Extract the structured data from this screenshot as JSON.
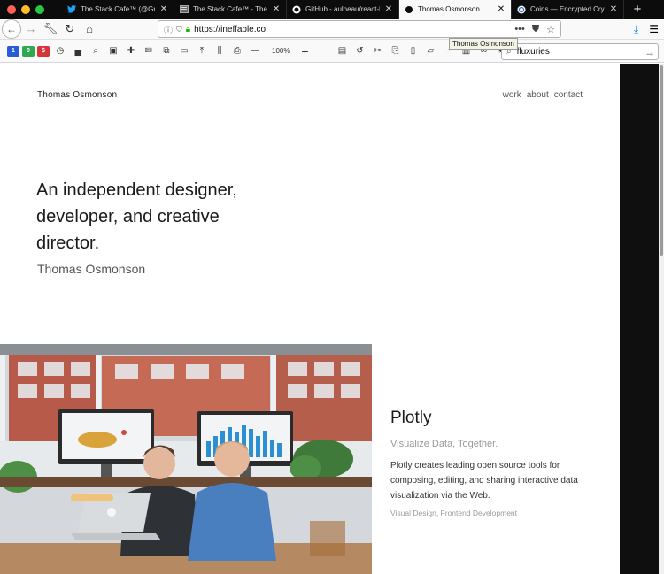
{
  "tabs": [
    {
      "label": "The Stack Cafe™ (@Grid",
      "icon": "twitter-icon",
      "active": false
    },
    {
      "label": "The Stack Cafe™ - The S",
      "icon": "page-icon",
      "active": false
    },
    {
      "label": "GitHub - aulneau/react-li",
      "icon": "github-icon",
      "active": false
    },
    {
      "label": "Thomas Osmonson",
      "icon": "dot-icon",
      "active": true
    },
    {
      "label": "Coins — Encrypted Crypt",
      "icon": "coin-icon",
      "active": false
    }
  ],
  "navbar": {
    "url": "https://ineffable.co",
    "tooltip": "Thomas Osmonson"
  },
  "toolbar": {
    "badges": [
      {
        "text": "1",
        "color": "#2a5bd7"
      },
      {
        "text": "0",
        "color": "#2fa84f"
      },
      {
        "text": "$",
        "color": "#d6333a"
      }
    ],
    "zoom": "100%"
  },
  "search": {
    "value": "fluxuries"
  },
  "site": {
    "brand": "Thomas Osmonson",
    "menu": [
      "work",
      "about",
      "contact"
    ],
    "hero": "An independent designer, developer, and creative director.",
    "hero_sub": "Thomas Osmonson"
  },
  "project": {
    "title": "Plotly",
    "tagline": "Visualize Data, Together.",
    "description": "Plotly creates leading open source tools for composing, editing, and sharing interactive data visualization via the Web.",
    "meta": "Visual Design, Frontend Development"
  },
  "colors": {
    "tabbar_bg": "#0c0c0d",
    "chrome_bg": "#f9f9fa",
    "dark_panel": "#0f0f0f"
  }
}
